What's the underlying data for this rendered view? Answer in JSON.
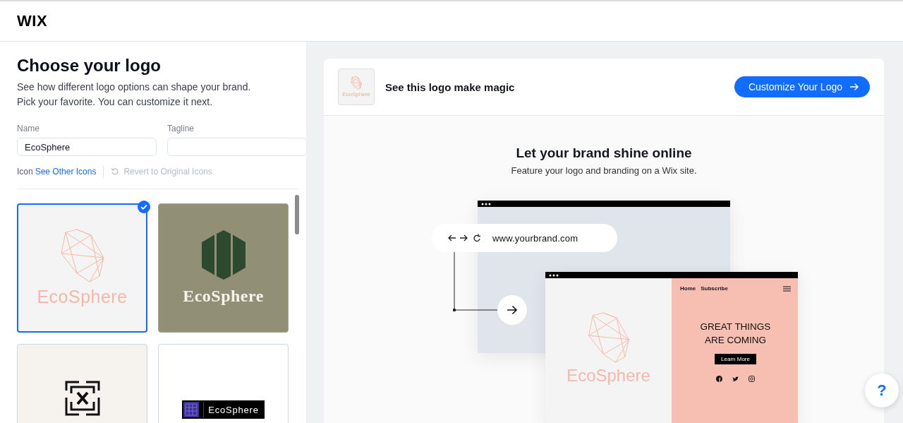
{
  "header": {
    "logo": "WIX"
  },
  "panel": {
    "title": "Choose your logo",
    "description": [
      "See how different logo options can shape your brand.",
      "Pick your favorite. You can customize it next."
    ],
    "fields": [
      {
        "label": "Name",
        "value": "EcoSphere"
      },
      {
        "label": "Tagline"
      }
    ],
    "icon_row": {
      "label": "Icon",
      "link": "See Other Icons",
      "revert": "Revert to Original Icons",
      "revert_disabled": true
    },
    "logos": [
      {
        "kind": "geometric",
        "name": "EcoSphere",
        "selected": true
      },
      {
        "kind": "hexagon",
        "name": "EcoSphere",
        "selected": false
      },
      {
        "kind": "maze",
        "selected": false
      },
      {
        "kind": "badge",
        "name": "EcoSphere",
        "selected": false
      }
    ]
  },
  "preview": {
    "title": "See this logo make magic",
    "thumb_name": "EcoSphere",
    "button": "Customize Your Logo"
  },
  "promo": {
    "title": "Let your brand shine online",
    "subtitle": "Feature your logo and branding on a Wix site."
  },
  "mockup": {
    "url": "www.yourbrand.com",
    "nav": [
      "Home",
      "Subscribe"
    ],
    "brand": "EcoSphere",
    "headline": [
      "GREAT THINGS",
      "ARE COMING"
    ],
    "cta": "Learn More"
  },
  "help": "?"
}
